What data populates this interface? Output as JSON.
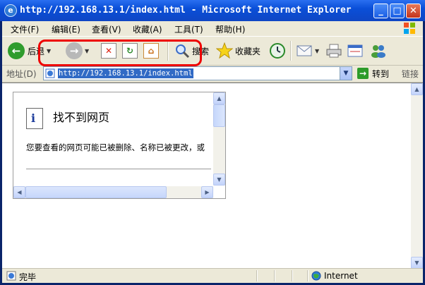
{
  "window": {
    "title": "http://192.168.13.1/index.html - Microsoft Internet Explorer"
  },
  "menu": [
    "文件(F)",
    "编辑(E)",
    "查看(V)",
    "收藏(A)",
    "工具(T)",
    "帮助(H)"
  ],
  "toolbar": {
    "back": "后退",
    "search": "搜索",
    "favorites": "收藏夹"
  },
  "address": {
    "label": "地址(D)",
    "url": "http://192.168.13.1/index.html",
    "go": "转到",
    "links": "链接"
  },
  "page": {
    "title": "找不到网页",
    "message": "您要查看的网页可能已被删除、名称已被更改，或"
  },
  "status": {
    "text": "完毕",
    "zone": "Internet"
  },
  "colors": {
    "highlight": "#e00000",
    "titlebar": "#0a4fd8",
    "selection": "#316ac5"
  }
}
